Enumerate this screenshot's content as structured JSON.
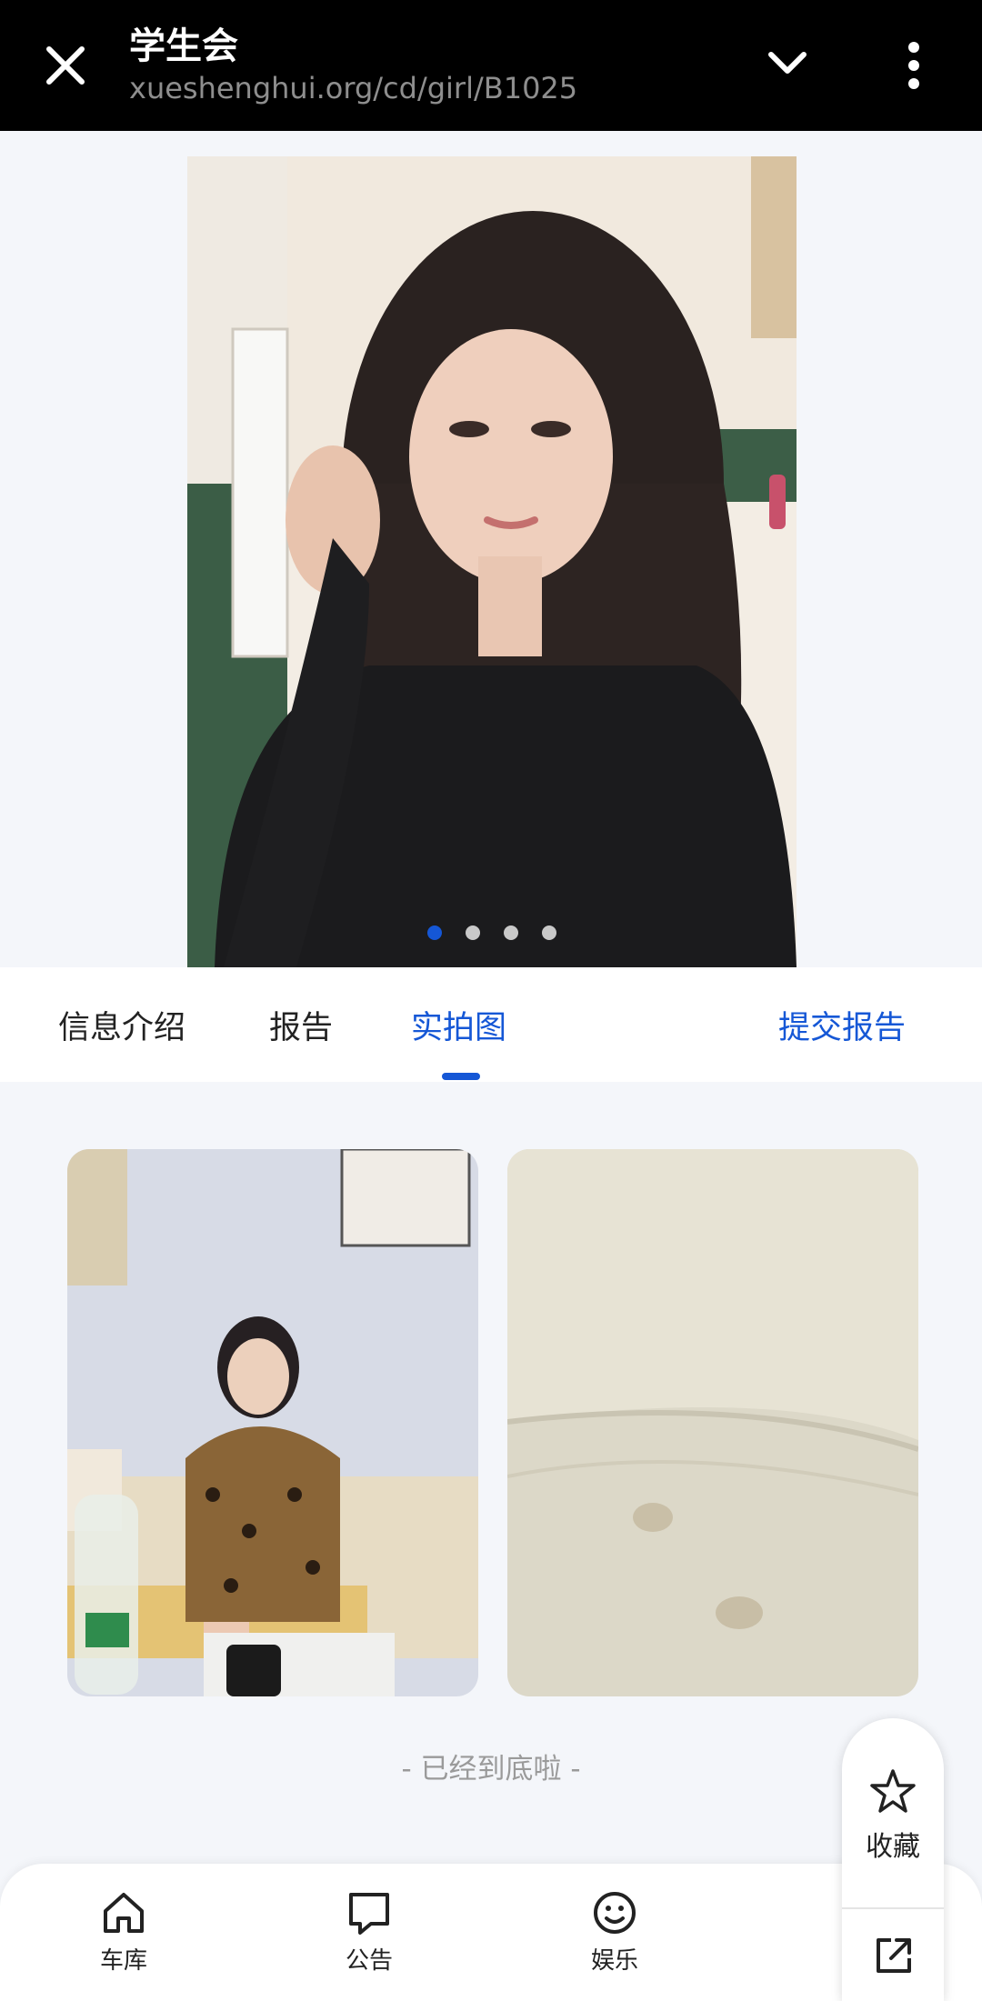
{
  "browser": {
    "title": "学生会",
    "url": "xueshenghui.org/cd/girl/B1025"
  },
  "hero": {
    "image": "portrait-photo",
    "carousel_total": 4,
    "carousel_active": 1
  },
  "tabs": [
    {
      "label": "信息介绍",
      "active": false
    },
    {
      "label": "报告",
      "active": false
    },
    {
      "label": "实拍图",
      "active": true
    }
  ],
  "submit_report_label": "提交报告",
  "gallery": [
    {
      "image": "photo-person-on-sofa"
    },
    {
      "image": "photo-bed-sheet"
    }
  ],
  "end_text": "- 已经到底啦 -",
  "bottom_nav": [
    {
      "label": "车库",
      "icon": "home-icon"
    },
    {
      "label": "公告",
      "icon": "message-icon"
    },
    {
      "label": "娱乐",
      "icon": "smile-icon"
    }
  ],
  "floating": {
    "favorite_label": "收藏",
    "favorite_icon": "star-icon",
    "share_icon": "share-icon"
  },
  "colors": {
    "accent": "#1557d6",
    "topbar": "#000000",
    "background": "#f4f6fa"
  }
}
